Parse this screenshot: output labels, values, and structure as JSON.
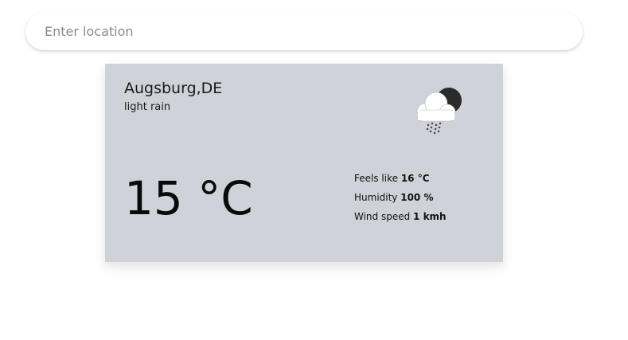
{
  "search": {
    "placeholder": "Enter location",
    "value": ""
  },
  "weather": {
    "location": "Augsburg,DE",
    "description": "light rain",
    "temperature": "15 °C",
    "icon": "light-rain-cloud-moon-icon",
    "details": [
      {
        "label": "Feels like",
        "value": "16 °C"
      },
      {
        "label": "Humidity",
        "value": "100 %"
      },
      {
        "label": "Wind speed",
        "value": "1 kmh"
      }
    ]
  },
  "colors": {
    "card_background": "#d0d2da",
    "page_background": "#ffffff"
  }
}
